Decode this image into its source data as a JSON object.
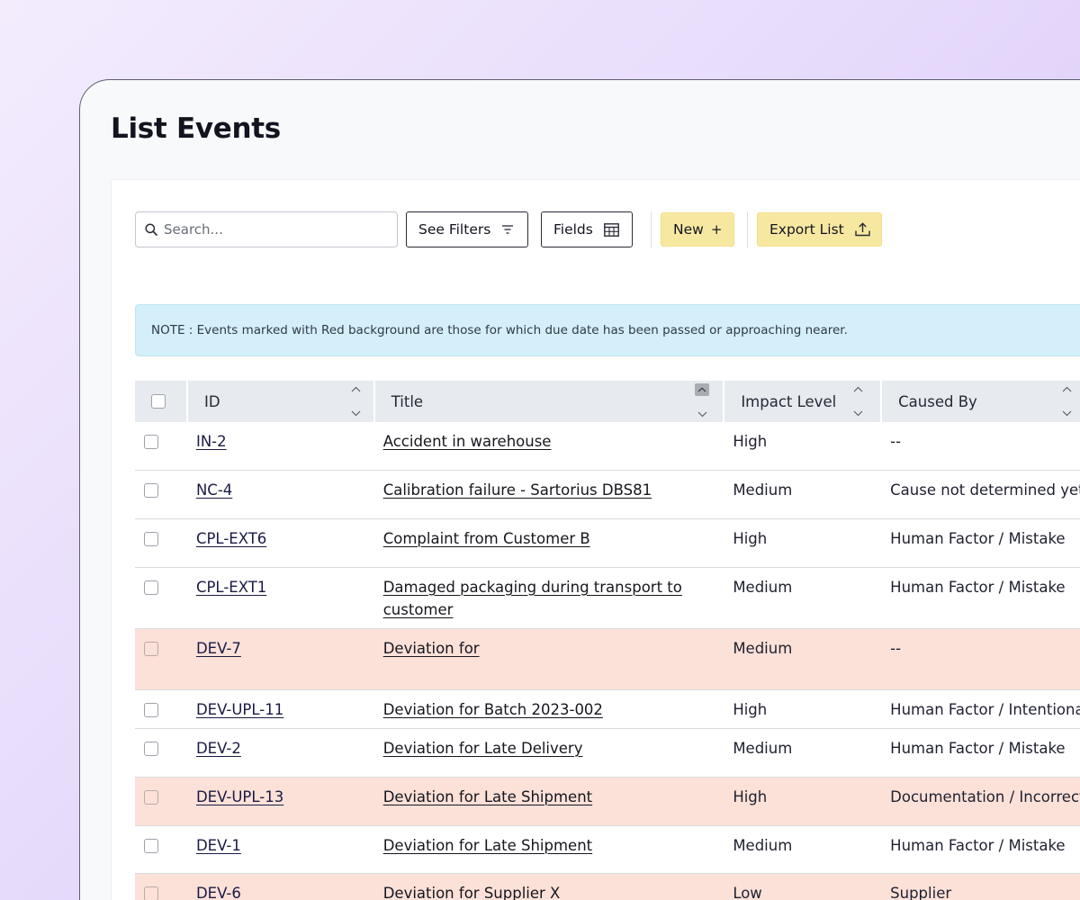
{
  "page": {
    "title": "List Events"
  },
  "toolbar": {
    "search_placeholder": "Search...",
    "filters_label": "See Filters",
    "fields_label": "Fields",
    "new_label": "New",
    "new_suffix": "+",
    "export_label": "Export List"
  },
  "note": "NOTE : Events marked with Red background are those for which due date has been passed or approaching nearer.",
  "columns": {
    "id": "ID",
    "title": "Title",
    "impact": "Impact Level",
    "cause": "Caused By"
  },
  "colors": {
    "overdue_row": "#fce1d8",
    "button_yellow": "#f7e8a1",
    "note_bg": "#d5effa"
  },
  "rows": [
    {
      "id": "IN-2",
      "title": "Accident in warehouse",
      "impact": "High",
      "cause": "--",
      "overdue": false
    },
    {
      "id": "NC-4",
      "title": "Calibration failure - Sartorius DBS81",
      "impact": "Medium",
      "cause": "Cause not determined yet",
      "overdue": false
    },
    {
      "id": "CPL-EXT6",
      "title": "Complaint from Customer B",
      "impact": "High",
      "cause": "Human Factor / Mistake",
      "overdue": false
    },
    {
      "id": "CPL-EXT1",
      "title": "Damaged packaging during transport to customer",
      "impact": "Medium",
      "cause": "Human Factor / Mistake",
      "overdue": false
    },
    {
      "id": "DEV-7",
      "title": "Deviation for",
      "impact": "Medium",
      "cause": "--",
      "overdue": true
    },
    {
      "id": "DEV-UPL-11",
      "title": "Deviation for Batch 2023-002",
      "impact": "High",
      "cause": "Human Factor / Intentional",
      "overdue": false
    },
    {
      "id": "DEV-2",
      "title": "Deviation for Late Delivery",
      "impact": "Medium",
      "cause": "Human Factor / Mistake",
      "overdue": false
    },
    {
      "id": "DEV-UPL-13",
      "title": "Deviation for Late Shipment",
      "impact": "High",
      "cause": "Documentation / Incorrect",
      "overdue": true
    },
    {
      "id": "DEV-1",
      "title": "Deviation for Late Shipment",
      "impact": "Medium",
      "cause": "Human Factor / Mistake",
      "overdue": false
    },
    {
      "id": "DEV-6",
      "title": "Deviation for Supplier X",
      "impact": "Low",
      "cause": "Supplier",
      "overdue": true
    }
  ]
}
